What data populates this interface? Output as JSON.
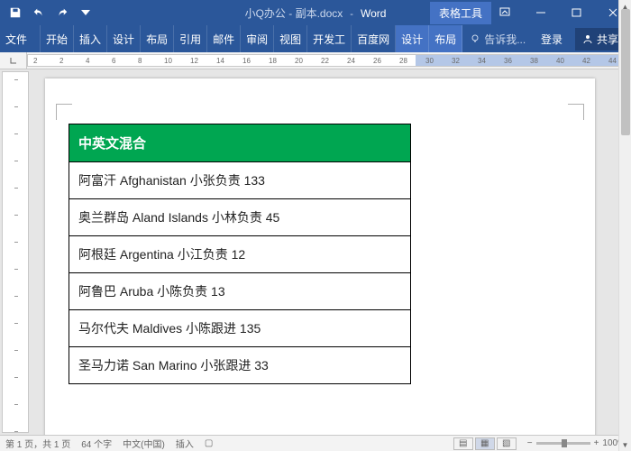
{
  "titlebar": {
    "doc": "小Q办公 - 副本.docx",
    "app": "Word",
    "tabletools": "表格工具"
  },
  "ribbon": {
    "file": "文件",
    "tabs": [
      "开始",
      "插入",
      "设计",
      "布局",
      "引用",
      "邮件",
      "审阅",
      "视图",
      "开发工",
      "百度网"
    ],
    "context": [
      "设计",
      "布局"
    ],
    "tell": "告诉我...",
    "login": "登录",
    "share": "共享"
  },
  "ruler": {
    "marks": [
      2,
      2,
      4,
      6,
      8,
      10,
      12,
      14,
      16,
      18,
      20,
      22,
      24,
      26,
      28,
      30,
      32,
      34,
      36,
      38,
      40,
      42,
      44
    ]
  },
  "table": {
    "header": "中英文混合",
    "rows": [
      "阿富汗 Afghanistan  小张负责  133",
      "奥兰群岛 Aland Islands  小林负责 45",
      "阿根廷 Argentina  小江负责  12",
      "阿鲁巴 Aruba  小陈负责  13",
      "马尔代夫 Maldives  小陈跟进  135",
      "圣马力诺 San Marino  小张跟进 33"
    ]
  },
  "status": {
    "page": "第 1 页，共 1 页",
    "words": "64 个字",
    "lang": "中文(中国)",
    "insert": "插入",
    "zoom": "100%"
  }
}
